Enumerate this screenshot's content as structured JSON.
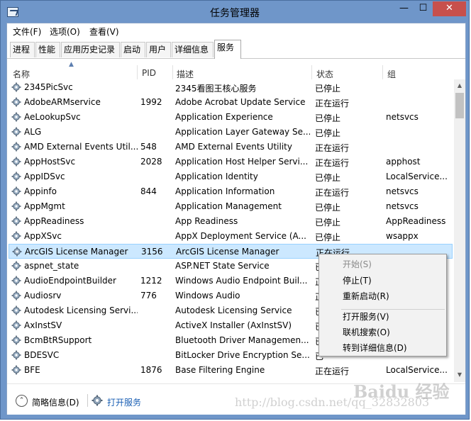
{
  "window": {
    "title": "任务管理器",
    "min_label": "—",
    "max_label": "☐",
    "close_label": "✕"
  },
  "menu": {
    "file": "文件(F)",
    "options": "选项(O)",
    "view": "查看(V)"
  },
  "tabs": [
    {
      "label": "进程"
    },
    {
      "label": "性能"
    },
    {
      "label": "应用历史记录"
    },
    {
      "label": "启动"
    },
    {
      "label": "用户"
    },
    {
      "label": "详细信息"
    },
    {
      "label": "服务",
      "active": true
    }
  ],
  "columns": {
    "name": "名称",
    "pid": "PID",
    "description": "描述",
    "status": "状态",
    "group": "组"
  },
  "rows": [
    {
      "name": "2345PicSvc",
      "pid": "",
      "desc": "2345看图王核心服务",
      "status": "已停止",
      "group": ""
    },
    {
      "name": "AdobeARMservice",
      "pid": "1992",
      "desc": "Adobe Acrobat Update Service",
      "status": "正在运行",
      "group": ""
    },
    {
      "name": "AeLookupSvc",
      "pid": "",
      "desc": "Application Experience",
      "status": "已停止",
      "group": "netsvcs"
    },
    {
      "name": "ALG",
      "pid": "",
      "desc": "Application Layer Gateway Se...",
      "status": "已停止",
      "group": ""
    },
    {
      "name": "AMD External Events Util...",
      "pid": "548",
      "desc": "AMD External Events Utility",
      "status": "正在运行",
      "group": ""
    },
    {
      "name": "AppHostSvc",
      "pid": "2028",
      "desc": "Application Host Helper Servi...",
      "status": "正在运行",
      "group": "apphost"
    },
    {
      "name": "AppIDSvc",
      "pid": "",
      "desc": "Application Identity",
      "status": "已停止",
      "group": "LocalService..."
    },
    {
      "name": "Appinfo",
      "pid": "844",
      "desc": "Application Information",
      "status": "正在运行",
      "group": "netsvcs"
    },
    {
      "name": "AppMgmt",
      "pid": "",
      "desc": "Application Management",
      "status": "已停止",
      "group": "netsvcs"
    },
    {
      "name": "AppReadiness",
      "pid": "",
      "desc": "App Readiness",
      "status": "已停止",
      "group": "AppReadiness"
    },
    {
      "name": "AppXSvc",
      "pid": "",
      "desc": "AppX Deployment Service (A...",
      "status": "已停止",
      "group": "wsappx"
    },
    {
      "name": "ArcGIS License Manager",
      "pid": "3156",
      "desc": "ArcGIS License Manager",
      "status": "正在运行",
      "group": "",
      "selected": true
    },
    {
      "name": "aspnet_state",
      "pid": "",
      "desc": "ASP.NET State Service",
      "status": "已",
      "group": ""
    },
    {
      "name": "AudioEndpointBuilder",
      "pid": "1212",
      "desc": "Windows Audio Endpoint Buil...",
      "status": "正",
      "group": ""
    },
    {
      "name": "Audiosrv",
      "pid": "776",
      "desc": "Windows Audio",
      "status": "正",
      "group": ""
    },
    {
      "name": "Autodesk Licensing Servi...",
      "pid": "",
      "desc": "Autodesk Licensing Service",
      "status": "已",
      "group": ""
    },
    {
      "name": "AxInstSV",
      "pid": "",
      "desc": "ActiveX Installer (AxInstSV)",
      "status": "已",
      "group": ""
    },
    {
      "name": "BcmBtRSupport",
      "pid": "",
      "desc": "Bluetooth Driver Managemen...",
      "status": "已",
      "group": ""
    },
    {
      "name": "BDESVC",
      "pid": "",
      "desc": "BitLocker Drive Encryption Se...",
      "status": "已",
      "group": ""
    },
    {
      "name": "BFE",
      "pid": "1876",
      "desc": "Base Filtering Engine",
      "status": "正在运行",
      "group": "LocalService..."
    }
  ],
  "context_menu": {
    "start": "开始(S)",
    "stop": "停止(T)",
    "restart": "重新启动(R)",
    "open_services": "打开服务(V)",
    "search_online": "联机搜索(O)",
    "go_to_details": "转到详细信息(D)"
  },
  "footer": {
    "less_details": "简略信息(D)",
    "open_services": "打开服务"
  },
  "watermark": {
    "baidu": "Baidu 经验",
    "url": "http://blog.csdn.net/qq_32832803"
  },
  "colors": {
    "title_bar": "#6f96c9",
    "close_button": "#c7504c",
    "selection": "#cce8ff",
    "link": "#1a5fb4"
  }
}
